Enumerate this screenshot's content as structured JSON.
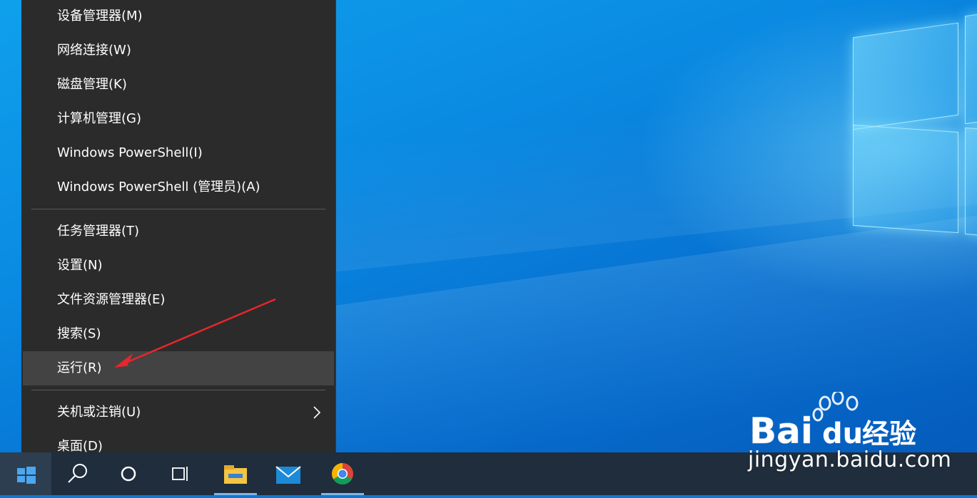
{
  "menu": {
    "groups": [
      {
        "items": [
          {
            "label": "设备管理器(M)"
          },
          {
            "label": "网络连接(W)"
          },
          {
            "label": "磁盘管理(K)"
          },
          {
            "label": "计算机管理(G)"
          },
          {
            "label": "Windows PowerShell(I)"
          },
          {
            "label": "Windows PowerShell (管理员)(A)"
          }
        ]
      },
      {
        "items": [
          {
            "label": "任务管理器(T)"
          },
          {
            "label": "设置(N)"
          },
          {
            "label": "文件资源管理器(E)"
          },
          {
            "label": "搜索(S)"
          },
          {
            "label": "运行(R)",
            "highlighted": true
          }
        ]
      },
      {
        "items": [
          {
            "label": "关机或注销(U)",
            "has_submenu": true
          },
          {
            "label": "桌面(D)"
          }
        ]
      }
    ]
  },
  "annotation": {
    "arrow_color": "#e8262b",
    "points_to": "运行(R)"
  },
  "taskbar": {
    "icons": [
      "start-icon",
      "search-icon",
      "cortana-icon",
      "task-view-icon",
      "file-explorer-icon",
      "mail-icon",
      "chrome-icon"
    ]
  },
  "watermark": {
    "brand": "Bai",
    "brand_du": "du",
    "brand_cn": "经验",
    "url": "jingyan.baidu.com"
  },
  "colors": {
    "menu_bg": "#2b2b2b",
    "menu_highlight": "#434343",
    "taskbar_bg": "#1f2d3c",
    "desktop_accent": "#0a78d7"
  }
}
